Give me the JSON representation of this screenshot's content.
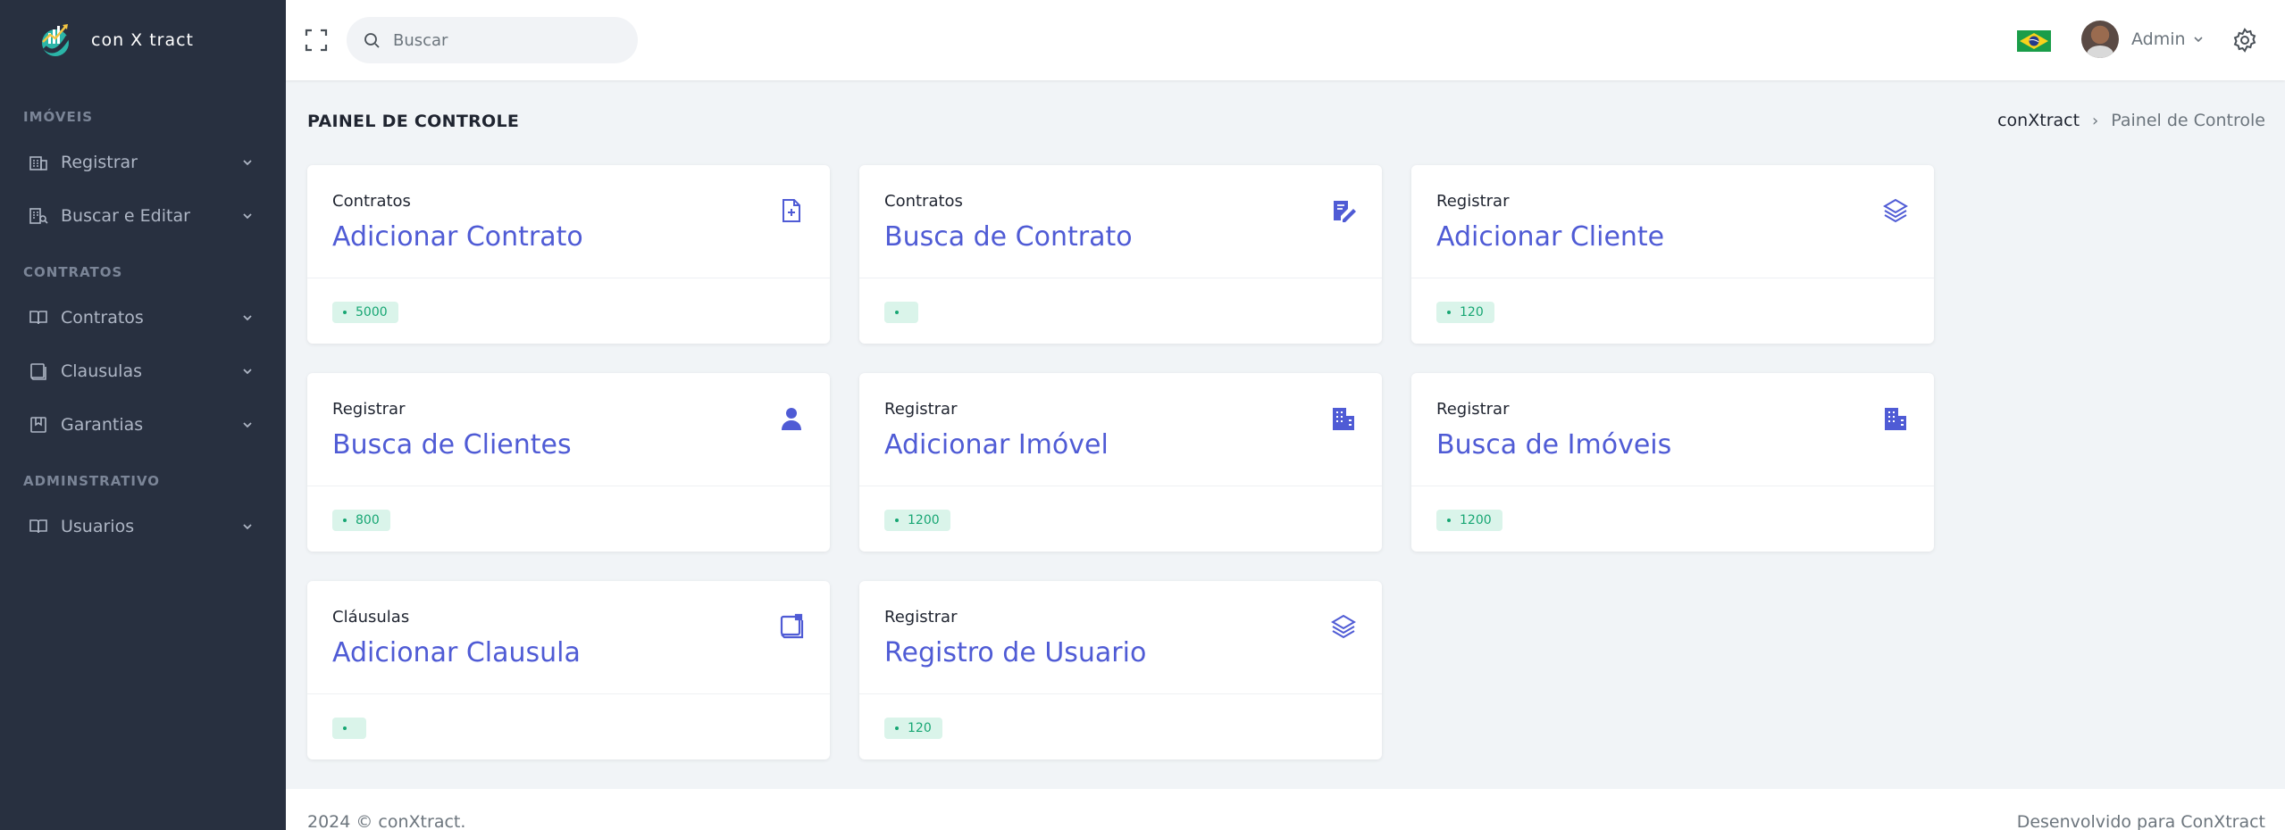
{
  "brand": {
    "name": "con X tract"
  },
  "sidebar": {
    "sections": [
      {
        "title": "IMÓVEIS",
        "items": [
          {
            "label": "Registrar",
            "icon": "building-icon"
          },
          {
            "label": "Buscar e Editar",
            "icon": "building-search-icon"
          }
        ]
      },
      {
        "title": "CONTRATOS",
        "items": [
          {
            "label": "Contratos",
            "icon": "book-icon"
          },
          {
            "label": "Clausulas",
            "icon": "clipboard-icon"
          },
          {
            "label": "Garantias",
            "icon": "bookmark-icon"
          }
        ]
      },
      {
        "title": "ADMINSTRATIVO",
        "items": [
          {
            "label": "Usuarios",
            "icon": "book-icon"
          }
        ]
      }
    ]
  },
  "topbar": {
    "search_placeholder": "Buscar",
    "user_name": "Admin",
    "language_flag": "brazil-flag"
  },
  "page": {
    "title": "PAINEL DE CONTROLE",
    "breadcrumb": {
      "home": "conXtract",
      "separator": "›",
      "current": "Painel de Controle"
    }
  },
  "cards": [
    {
      "category": "Contratos",
      "title": "Adicionar Contrato",
      "badge": "5000",
      "icon": "file-plus-icon"
    },
    {
      "category": "Contratos",
      "title": "Busca de Contrato",
      "badge": "",
      "icon": "edit-note-icon"
    },
    {
      "category": "Registrar",
      "title": "Adicionar Cliente",
      "badge": "120",
      "icon": "layers-icon"
    },
    {
      "category": "Registrar",
      "title": "Busca de Clientes",
      "badge": "800",
      "icon": "user-icon"
    },
    {
      "category": "Registrar",
      "title": "Adicionar Imóvel",
      "badge": "1200",
      "icon": "building-icon"
    },
    {
      "category": "Registrar",
      "title": "Busca de Imóveis",
      "badge": "1200",
      "icon": "building-icon"
    },
    {
      "category": "Cláusulas",
      "title": "Adicionar Clausula",
      "badge": "",
      "icon": "scroll-icon"
    },
    {
      "category": "Registrar",
      "title": "Registro de Usuario",
      "badge": "120",
      "icon": "layers-icon"
    }
  ],
  "footer": {
    "left": "2024 © conXtract.",
    "right": "Desenvolvido para ConXtract"
  },
  "colors": {
    "sidebar_bg": "#283040",
    "accent": "#4f5bd5",
    "badge_bg": "#daf4ea",
    "badge_text": "#17a673",
    "page_bg": "#f1f4f7"
  }
}
